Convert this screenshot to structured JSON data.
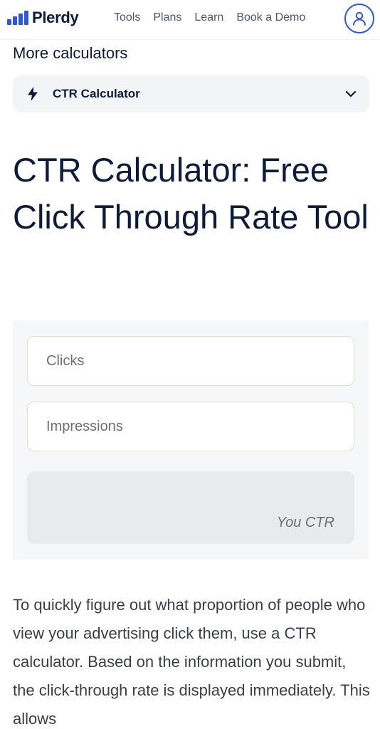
{
  "header": {
    "logo_text": "Plerdy",
    "nav": [
      "Tools",
      "Plans",
      "Learn",
      "Book a Demo"
    ],
    "account_icon": "user-icon"
  },
  "more_calculators": {
    "title": "More calculators",
    "selected": "CTR Calculator",
    "icon": "lightning-icon"
  },
  "page_title": "CTR Calculator: Free Click Through Rate Tool",
  "calculator": {
    "clicks_placeholder": "Clicks",
    "impressions_placeholder": "Impressions",
    "result_label": "You CTR"
  },
  "body_text": "To quickly figure out what proportion of people who view your advertising click them, use a CTR calculator. Based on the information you submit, the click-through rate is displayed immediately. This allows",
  "colors": {
    "brand_blue": "#2b56e6",
    "heading": "#0c1b3d"
  }
}
